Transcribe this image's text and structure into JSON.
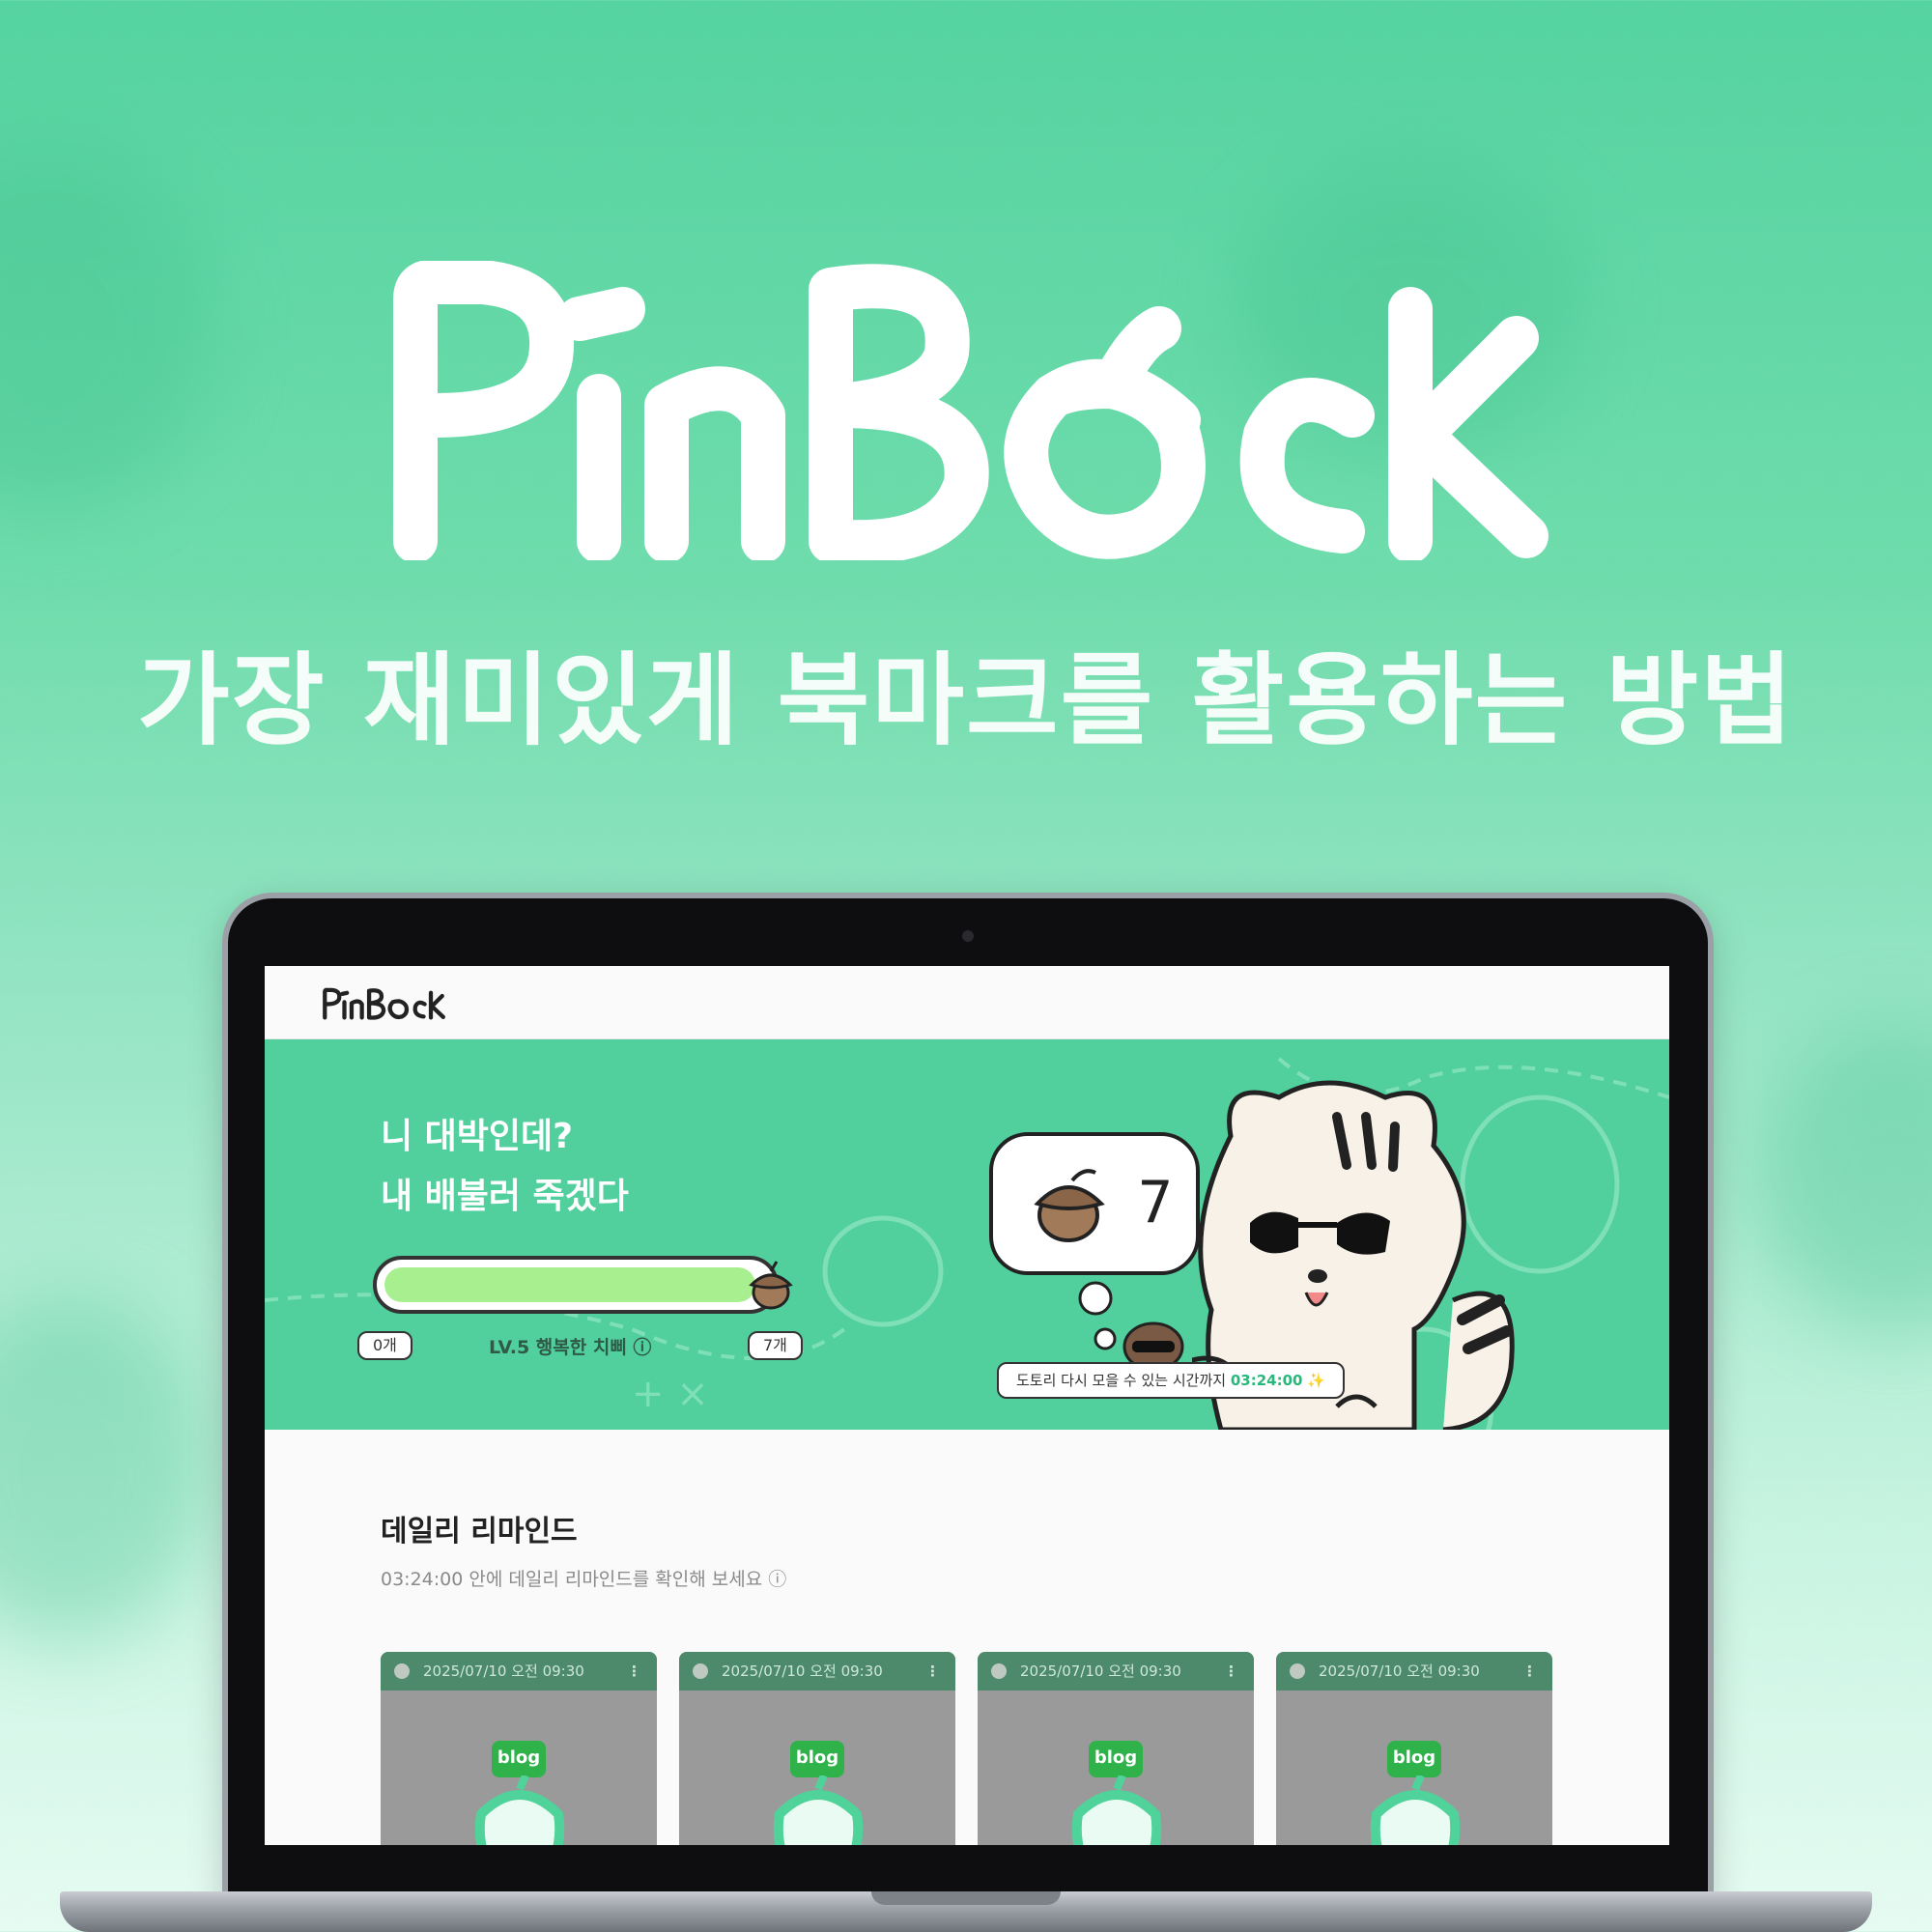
{
  "brand": {
    "name": "PINBOCK"
  },
  "hero": {
    "tagline": "가장 재미있게 북마크를 활용하는 방법"
  },
  "app": {
    "header_logo": "PINBOCK",
    "banner": {
      "line1": "니 대박인데?",
      "line2": "내 배불러 죽겠다",
      "progress": {
        "fraction": 0.97,
        "min_label": "0개",
        "max_label": "7개"
      },
      "level_label": "LV.5 행복한 치삐 ⓘ",
      "acorn_count": "7",
      "timer_prefix": "도토리 다시 모을 수 있는 시간까지",
      "timer_value": "03:24:00",
      "timer_suffix": "✨"
    },
    "reminder": {
      "title": "데일리 리마인드",
      "subtitle": "03:24:00 안에 데일리 리마인드를 확인해 보세요 ⓘ"
    },
    "cards": [
      {
        "date": "2025/07/10 오전 09:30",
        "badge": "blog"
      },
      {
        "date": "2025/07/10 오전 09:30",
        "badge": "blog"
      },
      {
        "date": "2025/07/10 오전 09:30",
        "badge": "blog"
      },
      {
        "date": "2025/07/10 오전 09:30",
        "badge": "blog"
      }
    ]
  },
  "colors": {
    "brand_green": "#51cf9d",
    "accent_green": "#29b87b",
    "progress_fill": "#a8ef8f"
  }
}
